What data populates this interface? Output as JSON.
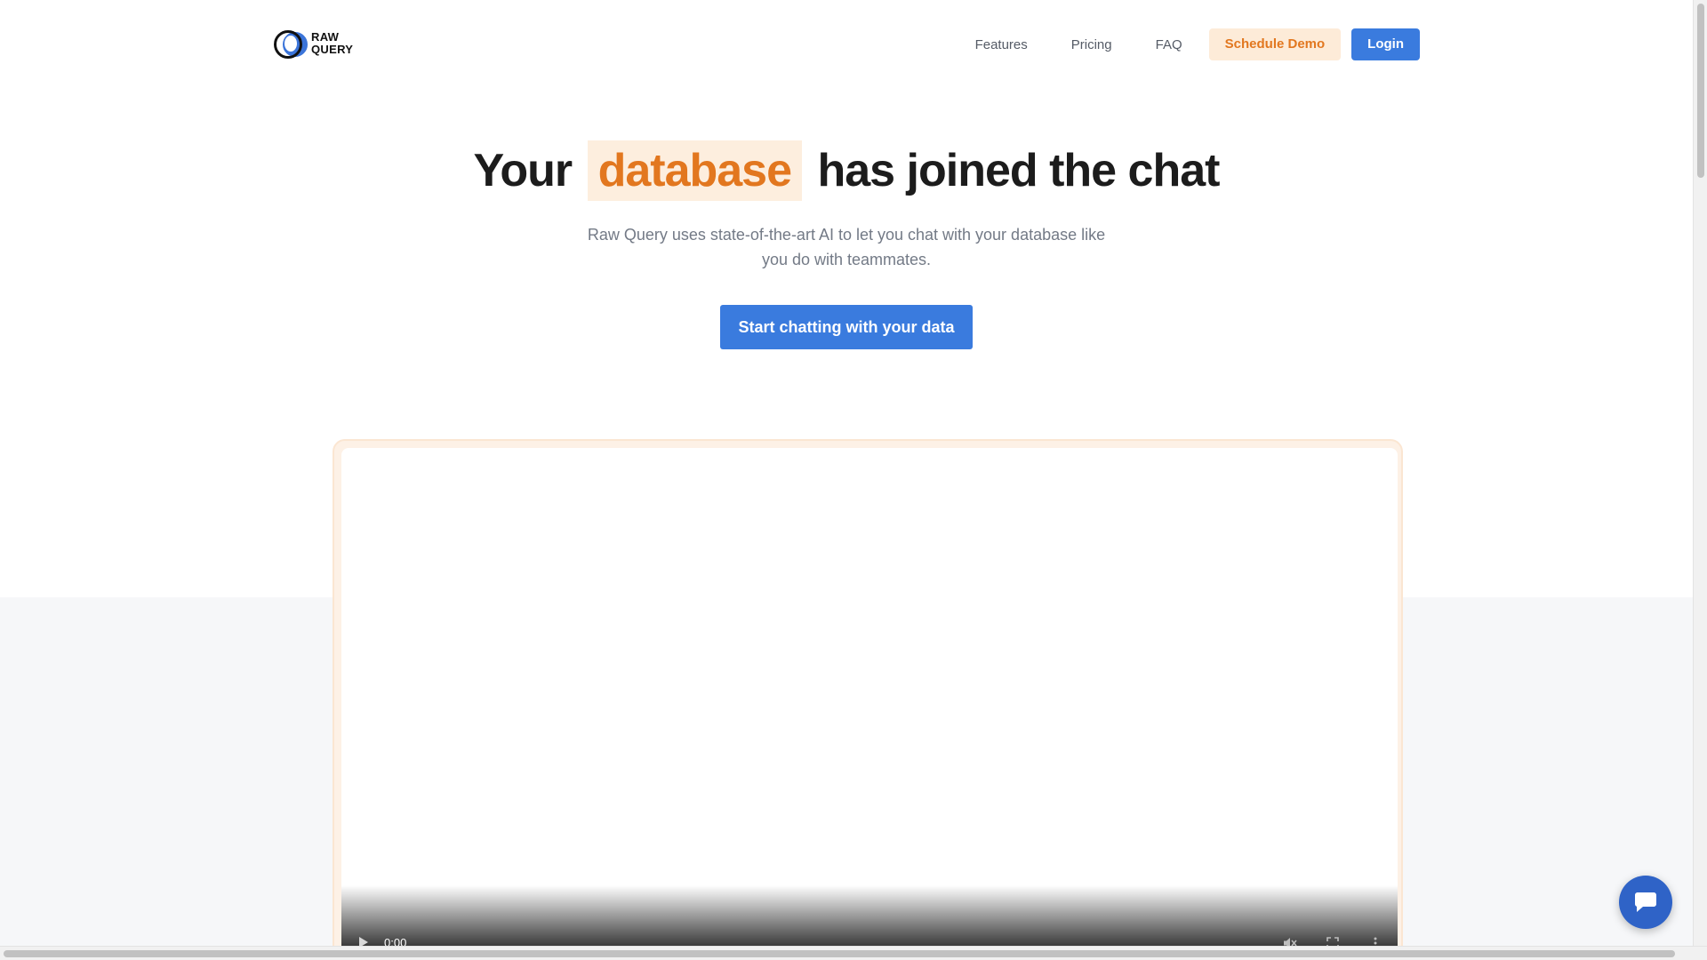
{
  "brand": {
    "logo_line1": "RAW",
    "logo_line2": "QUERY",
    "primary_color": "#3a7bde",
    "accent_color": "#e2771f"
  },
  "nav": {
    "links": [
      "Features",
      "Pricing",
      "FAQ"
    ],
    "schedule_demo": "Schedule Demo",
    "login": "Login"
  },
  "hero": {
    "title_before": "Your",
    "title_highlight": "database",
    "title_after": "has joined the chat",
    "subtitle": "Raw Query uses state-of-the-art AI to let you chat with your database like you do with teammates.",
    "cta": "Start chatting with your data"
  },
  "video": {
    "time": "0:00",
    "play_icon": "play-icon",
    "mute_icon": "muted-speaker-icon",
    "fullscreen_icon": "fullscreen-icon",
    "more_icon": "more-options-icon"
  },
  "chat_widget": {
    "icon": "chat-bubble-icon"
  }
}
